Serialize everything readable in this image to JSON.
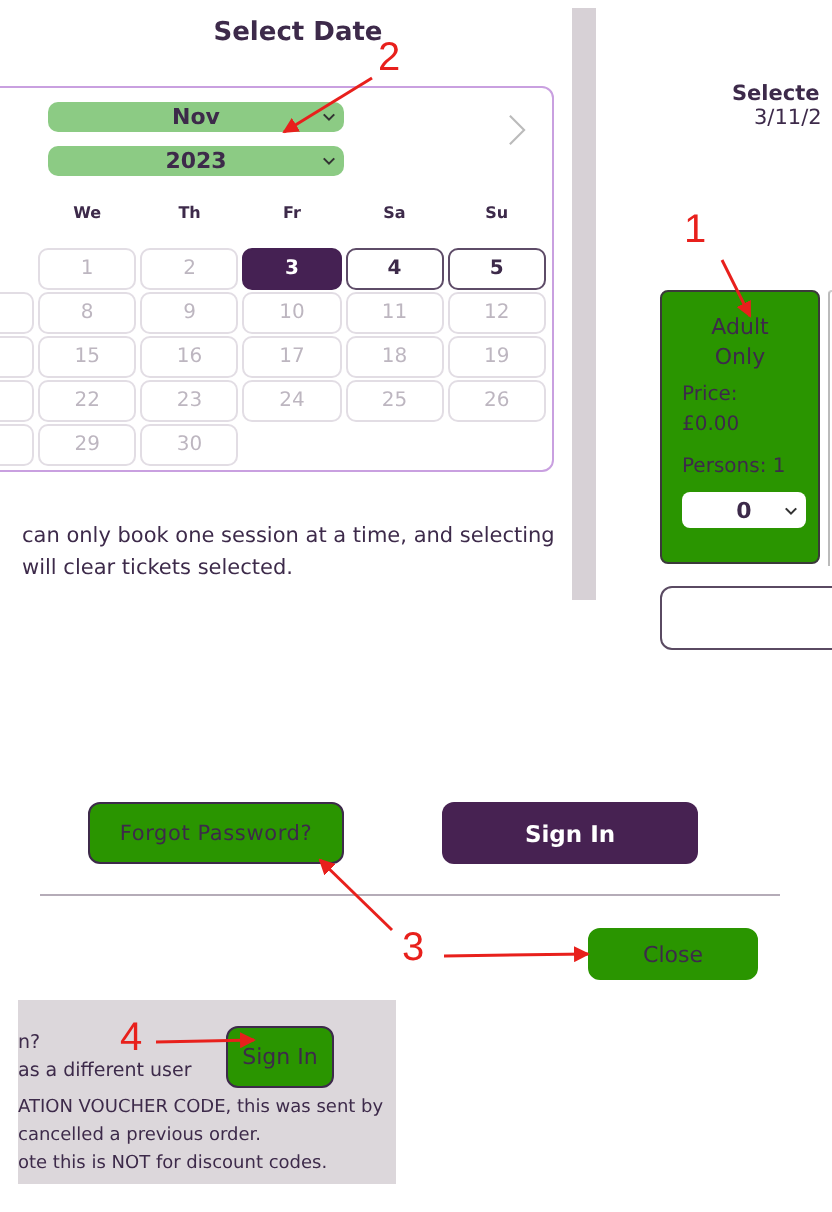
{
  "calendar": {
    "title": "Select Date",
    "month": "Nov",
    "year": "2023",
    "weekdays": [
      "We",
      "Th",
      "Fr",
      "Sa",
      "Su"
    ],
    "weeks": [
      {
        "cut_cell": false,
        "days": [
          {
            "label": "1",
            "available": false,
            "selected": false
          },
          {
            "label": "2",
            "available": false,
            "selected": false
          },
          {
            "label": "3",
            "available": true,
            "selected": true
          },
          {
            "label": "4",
            "available": true,
            "selected": false
          },
          {
            "label": "5",
            "available": true,
            "selected": false
          }
        ]
      },
      {
        "cut_cell": true,
        "days": [
          {
            "label": "8",
            "available": false,
            "selected": false
          },
          {
            "label": "9",
            "available": false,
            "selected": false
          },
          {
            "label": "10",
            "available": false,
            "selected": false
          },
          {
            "label": "11",
            "available": false,
            "selected": false
          },
          {
            "label": "12",
            "available": false,
            "selected": false
          }
        ]
      },
      {
        "cut_cell": true,
        "days": [
          {
            "label": "15",
            "available": false,
            "selected": false
          },
          {
            "label": "16",
            "available": false,
            "selected": false
          },
          {
            "label": "17",
            "available": false,
            "selected": false
          },
          {
            "label": "18",
            "available": false,
            "selected": false
          },
          {
            "label": "19",
            "available": false,
            "selected": false
          }
        ]
      },
      {
        "cut_cell": true,
        "days": [
          {
            "label": "22",
            "available": false,
            "selected": false
          },
          {
            "label": "23",
            "available": false,
            "selected": false
          },
          {
            "label": "24",
            "available": false,
            "selected": false
          },
          {
            "label": "25",
            "available": false,
            "selected": false
          },
          {
            "label": "26",
            "available": false,
            "selected": false
          }
        ]
      },
      {
        "cut_cell": true,
        "days": [
          {
            "label": "29",
            "available": false,
            "selected": false
          },
          {
            "label": "30",
            "available": false,
            "selected": false
          }
        ]
      }
    ],
    "note": [
      "can only book one session at a time, and selecting",
      "will clear tickets selected."
    ]
  },
  "selection": {
    "heading": "Selecte",
    "date": "3/11/2"
  },
  "ticket": {
    "name": "Adult Only",
    "price_label": "Price:",
    "price": "£0.00",
    "persons": "Persons: 1",
    "quantity": "0"
  },
  "login": {
    "forgot": "Forgot Password?",
    "sign_in": "Sign In",
    "close": "Close"
  },
  "notice": {
    "lines_top": [
      "n?",
      "as a different user"
    ],
    "sign_in": "Sign In",
    "lines_bottom": [
      "ATION VOUCHER CODE, this was sent by",
      "cancelled a previous order.",
      "ote this is NOT for discount codes."
    ]
  },
  "annotations": [
    {
      "number": "2"
    },
    {
      "number": "1"
    },
    {
      "number": "3"
    },
    {
      "number": "4"
    }
  ]
}
